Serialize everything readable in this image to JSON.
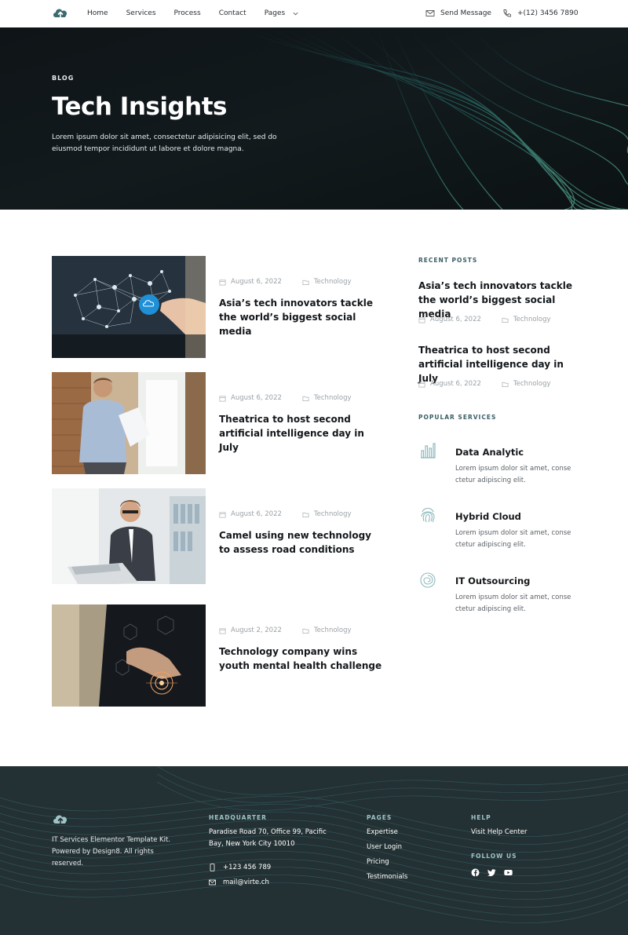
{
  "nav": {
    "menu": [
      "Home",
      "Services",
      "Process",
      "Contact",
      "Pages"
    ],
    "send_message": "Send Message",
    "phone": "+(12) 3456 7890",
    "icons": {
      "logo": "cloud-upload-icon",
      "message": "envelope-icon",
      "phone": "phone-icon",
      "pages": "chevron-down-icon"
    }
  },
  "hero": {
    "kicker": "BLOG",
    "title": "Tech Insights",
    "text": "Lorem ipsum dolor sit amet, consectetur adipisicing elit, sed do eiusmod tempor incididunt ut labore et dolore magna."
  },
  "posts": [
    {
      "date": "August 6, 2022",
      "category": "Technology",
      "title": "Asia’s tech innovators tackle the world’s biggest social media"
    },
    {
      "date": "August 6, 2022",
      "category": "Technology",
      "title": "Theatrica to host second artificial intelligence day in July"
    },
    {
      "date": "August 6, 2022",
      "category": "Technology",
      "title": "Camel using new technology to assess road conditions"
    },
    {
      "date": "August 2, 2022",
      "category": "Technology",
      "title": "Technology company wins youth mental health challenge"
    }
  ],
  "sidebar": {
    "recent_heading": "RECENT POSTS",
    "recent": [
      {
        "title": "Asia’s tech innovators tackle the world’s biggest social media",
        "date": "August 6, 2022",
        "category": "Technology"
      },
      {
        "title": "Theatrica to host second artificial intelligence day in July",
        "date": "August 6, 2022",
        "category": "Technology"
      }
    ],
    "services_heading": "POPULAR SERVICES",
    "services": [
      {
        "name": "Data Analytic",
        "desc": "Lorem ipsum dolor sit amet, conse ctetur adipiscing elit.",
        "icon": "bar-chart-icon"
      },
      {
        "name": "Hybrid Cloud",
        "desc": "Lorem ipsum dolor sit amet, conse ctetur adipiscing elit.",
        "icon": "fingerprint-icon"
      },
      {
        "name": "IT Outsourcing",
        "desc": "Lorem ipsum dolor sit amet, conse ctetur adipiscing elit.",
        "icon": "spiral-icon"
      }
    ]
  },
  "footer": {
    "about": "IT Services Elementor Template Kit. Powered by Design8. All rights reserved.",
    "headquarter_heading": "HEADQUARTER",
    "address": "Paradise Road 70, Office 99, Pacific Bay,  New York City 10010",
    "phone": "+123 456 789",
    "email": "mail@virte.ch",
    "pages_heading": "PAGES",
    "pages": [
      "Expertise",
      "User Login",
      "Pricing",
      "Testimonials"
    ],
    "help_heading": "HELP",
    "help_link": "Visit Help Center",
    "follow_heading": "FOLLOW US",
    "social": [
      "facebook-icon",
      "twitter-icon",
      "youtube-icon"
    ]
  },
  "colors": {
    "accent": "#3a7f86",
    "hero_bg": "#101418",
    "footer_bg": "#243134"
  }
}
